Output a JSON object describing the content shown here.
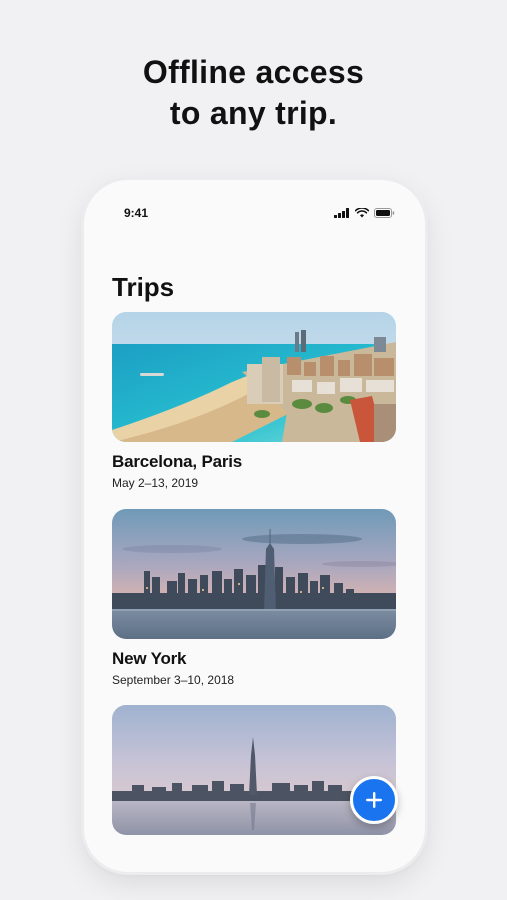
{
  "headline": {
    "line1": "Offline access",
    "line2": "to any trip."
  },
  "status_bar": {
    "time": "9:41",
    "icons": [
      "signal-icon",
      "wifi-icon",
      "battery-icon"
    ]
  },
  "screen": {
    "title": "Trips"
  },
  "trips": [
    {
      "name": "Barcelona, Paris",
      "dates": "May 2–13, 2019",
      "photo": "barcelona-beach-skyline"
    },
    {
      "name": "New York",
      "dates": "September 3–10, 2018",
      "photo": "new-york-skyline"
    },
    {
      "name": "",
      "dates": "",
      "photo": "seoul-skyline"
    }
  ],
  "add_button": {
    "icon": "plus-icon"
  },
  "colors": {
    "accent": "#1a74f0",
    "background": "#f1f1f3",
    "phone": "#fafafb"
  }
}
